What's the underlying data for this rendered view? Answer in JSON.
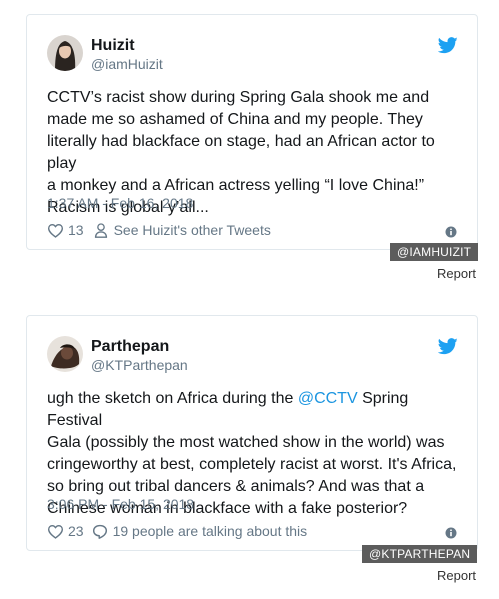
{
  "tweets": [
    {
      "name": "Huizit",
      "handle": "@iamHuizit",
      "text_lines": [
        "CCTV’s racist show during Spring Gala shook me and",
        "made me so ashamed of China and my people. They",
        "literally had blackface on stage, had an African actor to play",
        "a monkey and a African actress yelling “I love China!”",
        "Racism is global y’all..."
      ],
      "date": "1:37 AM - Feb 16, 2018",
      "likes": "13",
      "action_label": "See Huizit's other Tweets",
      "action_icon": "person-icon",
      "credit_tag": "@IAMHUIZIT",
      "report_label": "Report"
    },
    {
      "name": "Parthepan",
      "handle": "@KTParthepan",
      "text_line1_before": "ugh the sketch on Africa during the ",
      "text_line1_mention": "@CCTV",
      "text_line1_after": " Spring Festival",
      "text_lines_rest": [
        "Gala (possibly the most watched show in the world) was",
        "cringeworthy at best, completely racist at worst. It's Africa,",
        "so bring out tribal dancers & animals? And was that a",
        "Chinese woman in blackface with a fake posterior?"
      ],
      "date": "3:06 PM - Feb 15, 2018",
      "likes": "23",
      "action_label": "19 people are talking about this",
      "action_icon": "speech-bubble-icon",
      "credit_tag": "@KTPARTHEPAN",
      "report_label": "Report"
    }
  ],
  "colors": {
    "twitter_blue": "#1da1f2",
    "secondary_text": "#657786",
    "mention": "#1b95e0",
    "tag_bg": "#5c5c5c"
  }
}
